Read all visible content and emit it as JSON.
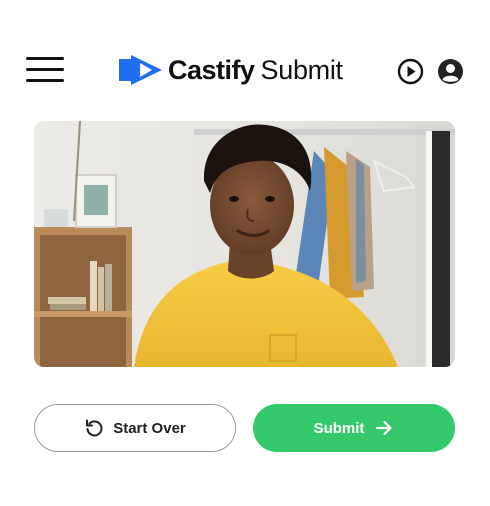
{
  "header": {
    "brand_name": "Castify",
    "brand_suffix": "Submit",
    "icons": {
      "menu": "hamburger-menu-icon",
      "logo": "castify-logo-icon",
      "play": "play-circle-icon",
      "user": "user-account-icon"
    }
  },
  "media": {
    "icon": "photo-preview"
  },
  "actions": {
    "start_over_label": "Start Over",
    "submit_label": "Submit",
    "icons": {
      "start_over": "rotate-left-icon",
      "submit": "arrow-right-icon"
    }
  },
  "colors": {
    "brand_blue": "#1f6ff0",
    "submit_green": "#35c96b",
    "text_dark": "#111111",
    "shirt_yellow": "#f2c53d"
  }
}
